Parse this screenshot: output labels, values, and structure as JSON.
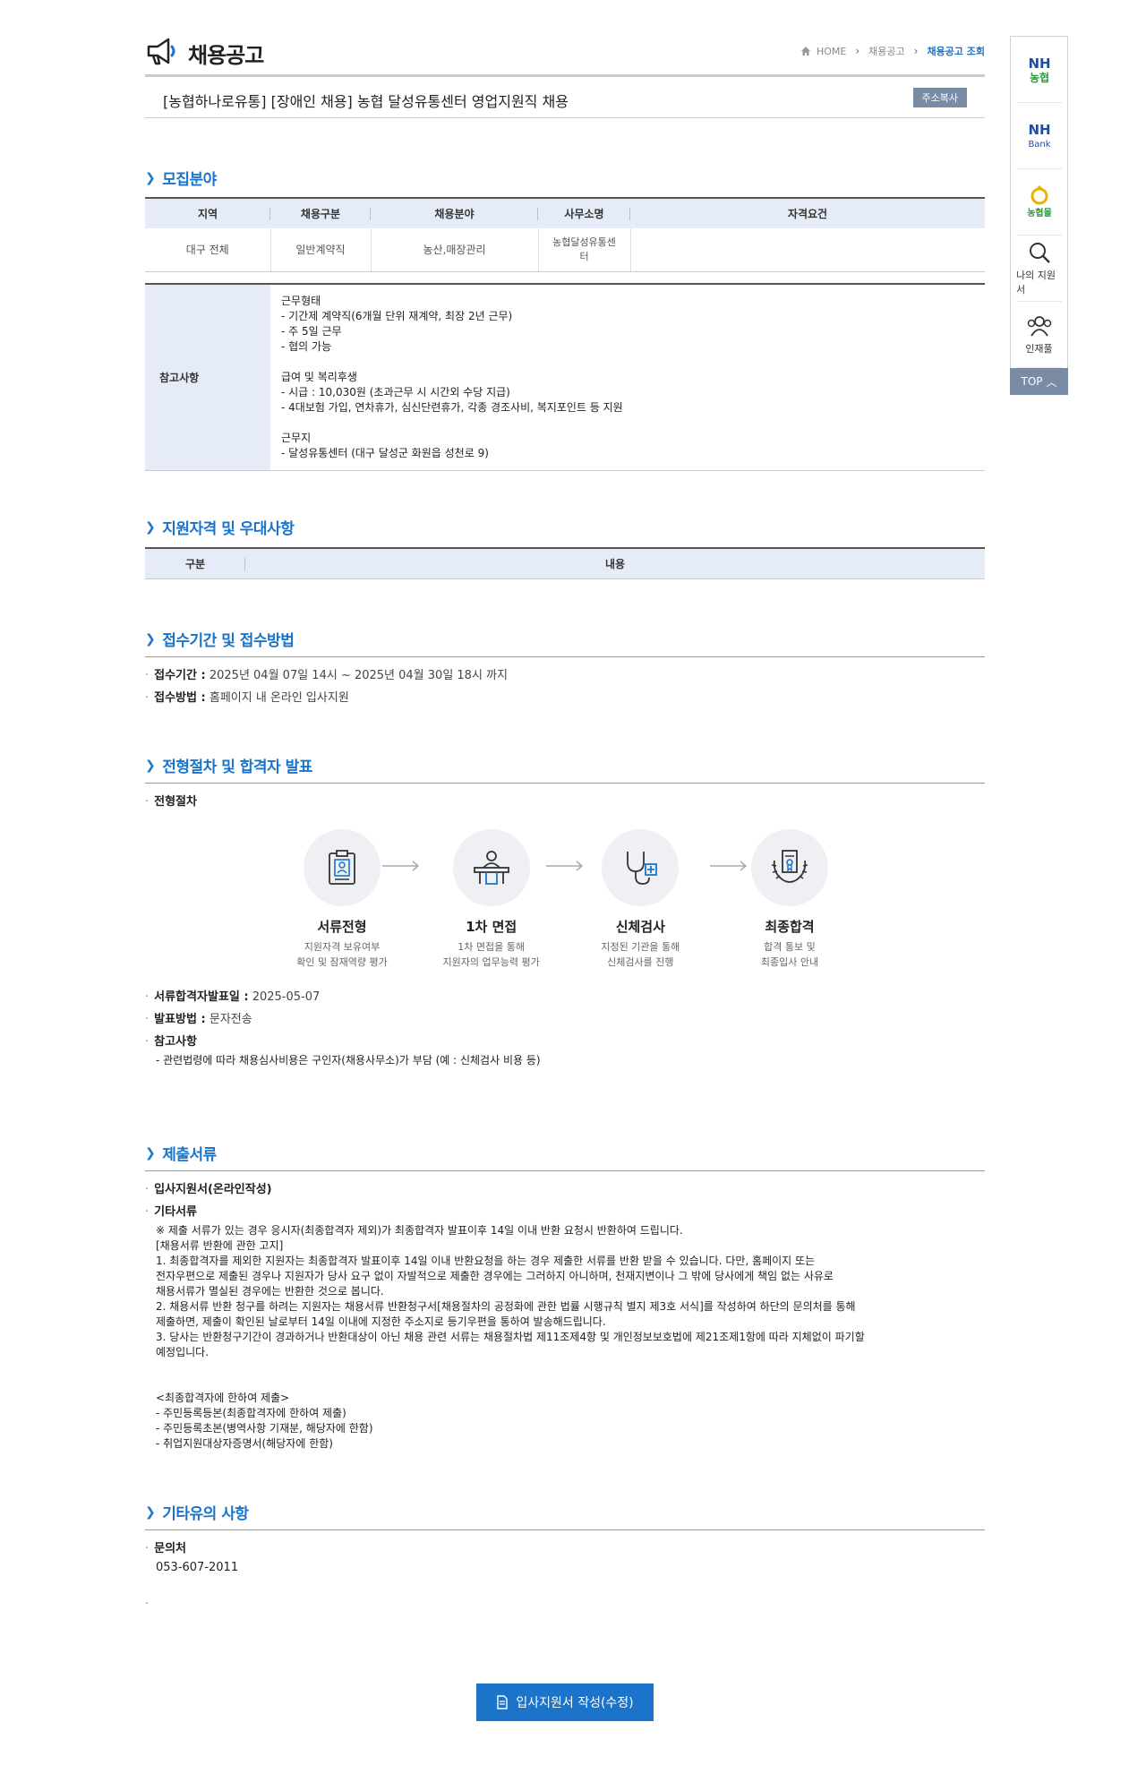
{
  "header": {
    "title": "채용공고",
    "breadcrumb": [
      "HOME",
      "채용공고",
      "채용공고 조회"
    ]
  },
  "job": {
    "title": "[농협하나로유통] [장애인 채용] 농협 달성유통센터 영업지원직 채용",
    "copy_label": "주소복사"
  },
  "recruit": {
    "section_title": "모집분야",
    "columns": [
      "지역",
      "채용구분",
      "채용분야",
      "사무소명",
      "자격요건"
    ],
    "row": [
      "대구 전체",
      "일반계약직",
      "농산,매장관리",
      "농협달성유통센\n터",
      ""
    ],
    "notes_label": "참고사항",
    "notes": "근무형태\n- 기간제 계약직(6개월 단위 재계약, 최장 2년 근무)\n- 주 5일 근무\n- 협의 가능\n\n급여 및 복리후생\n- 시급 : 10,030원 (초과근무 시 시간외 수당 지급)\n- 4대보험 가입, 연차휴가, 심신단련휴가, 각종 경조사비, 복지포인트 등 지원\n\n근무지\n- 달성유통센터 (대구 달성군 화원읍 성천로 9)"
  },
  "qualification": {
    "section_title": "지원자격 및 우대사항",
    "columns": [
      "구분",
      "내용"
    ]
  },
  "period": {
    "section_title": "접수기간 및 접수방법",
    "period_label": "접수기간 :",
    "period_value": "2025년 04월 07일 14시 ~ 2025년 04월 30일 18시 까지",
    "method_label": "접수방법 :",
    "method_value": "홈페이지 내 온라인 입사지원"
  },
  "process": {
    "section_title": "전형절차 및 합격자 발표",
    "sub_label": "전형절차",
    "steps": [
      {
        "title": "서류전형",
        "desc": "지원자격 보유여부\n확인 및 잠재역량 평가",
        "icon": "document-icon"
      },
      {
        "title": "1차 면접",
        "desc": "1차 면접을 통해\n지원자의 업무능력 평가",
        "icon": "interview-icon"
      },
      {
        "title": "신체검사",
        "desc": "지정된 기관을 통해\n신체검사를 진행",
        "icon": "stethoscope-icon"
      },
      {
        "title": "최종합격",
        "desc": "합격 통보 및\n최종입사 안내",
        "icon": "certificate-icon"
      }
    ],
    "announce_label": "서류합격자발표일 :",
    "announce_value": "2025-05-07",
    "notice_label": "발표방법 :",
    "notice_value": "문자전송",
    "ref_label": "참고사항",
    "ref_value": "- 관련법령에 따라 채용심사비용은 구인자(채용사무소)가 부담 (예 : 신체검사 비용 등)"
  },
  "documents": {
    "section_title": "제출서류",
    "item1": "입사지원서(온라인작성)",
    "item2": "기타서류",
    "text": "※ 제출 서류가 있는 경우 응시자(최종합격자 제외)가 최종합격자 발표이후 14일 이내 반환 요청시 반환하여 드립니다.\n[채용서류 반환에 관한 고지]\n 1. 최종합격자를 제외한 지원자는 최종합격자 발표이후 14일 이내 반환요청을 하는 경우 제출한 서류를 반환 받을 수 있습니다. 다만, 홈페이지 또는\n전자우편으로 제출된 경우나 지원자가 당사 요구 없이 자발적으로 제출한 경우에는 그러하지 아니하며, 천재지변이나 그 밖에 당사에게 책임 없는 사유로\n채용서류가 멸실된 경우에는 반환한 것으로 봅니다.\n 2. 채용서류 반환 청구를 하려는 지원자는 채용서류 반환청구서[채용절차의 공정화에 관한 법률 시행규칙 별지 제3호 서식]를 작성하여 하단의 문의처를 통해\n제출하면, 제출이 확인된 날로부터 14일 이내에 지정한 주소지로 등기우편을 통하여 발송해드립니다.\n 3. 당사는 반환청구기간이 경과하거나 반환대상이 아닌 채용 관련 서류는 채용절차법 제11조제4항 및 개인정보보호법에 제21조제1항에 따라 지체없이 파기할\n예정입니다.\n\n\n <최종합격자에 한하여 제출>\n- 주민등록등본(최종합격자에 한하여 제출)\n- 주민등록초본(병역사항 기재분, 해당자에 한함)\n- 취업지원대상자증명서(해당자에 한함)"
  },
  "etc": {
    "section_title": "기타유의 사항",
    "contact_label": "문의처",
    "contact_value": "053-607-2011"
  },
  "apply_button": "입사지원서 작성(수정)",
  "quick_menu": {
    "items": [
      {
        "label": "NH\n농협"
      },
      {
        "label": "NH\nBank"
      },
      {
        "label": "농협몰"
      },
      {
        "label": "나의 지원서"
      },
      {
        "label": "인재풀"
      }
    ],
    "top": "TOP"
  },
  "colors": {
    "accent": "#1b74c9",
    "table_header": "#e5ecf7",
    "nh_green": "#2e9c3f",
    "nh_blue": "#1b4ea8"
  }
}
